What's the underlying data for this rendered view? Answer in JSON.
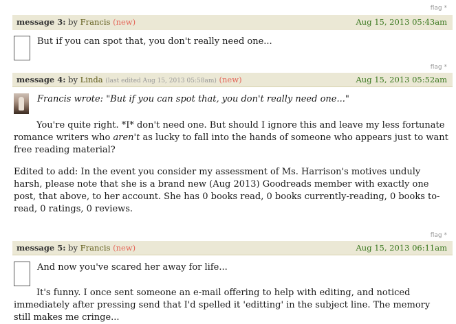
{
  "flag": {
    "label": "flag",
    "star": "*"
  },
  "posts": [
    {
      "label": "message 3:",
      "by": "by",
      "user": "Francis",
      "edited": "",
      "new": "(new)",
      "date": "Aug 15, 2013 05:43am",
      "body": [
        "But if you can spot that, you don't really need one..."
      ]
    },
    {
      "label": "message 4:",
      "by": "by",
      "user": "Linda",
      "edited": "(last edited Aug 15, 2013 05:58am)",
      "new": "(new)",
      "date": "Aug 15, 2013 05:52am",
      "quote": "Francis wrote: \"But if you can spot that, you don't really need one...\"",
      "p1_before": "You're quite right. *I* don't need one. But should I ignore this and leave my less fortunate romance writers who ",
      "p1_em": "aren't",
      "p1_after": " as lucky to fall into the hands of someone who appears just to want free reading material?",
      "p2": "Edited to add: In the event you consider my assessment of Ms. Harrison's motives unduly harsh, please note that she is a brand new (Aug 2013) Goodreads member with exactly one post, that above, to her account. She has 0 books read, 0 books currently-reading, 0 books to-read, 0 ratings, 0 reviews."
    },
    {
      "label": "message 5:",
      "by": "by",
      "user": "Francis",
      "edited": "",
      "new": "(new)",
      "date": "Aug 15, 2013 06:11am",
      "body": [
        "And now you've scared her away for life...",
        "It's funny. I once sent someone an e-mail offering to help with editing, and noticed immediately after pressing send that I'd spelled it 'editting' in the subject line. The memory still makes me cringe..."
      ]
    }
  ]
}
